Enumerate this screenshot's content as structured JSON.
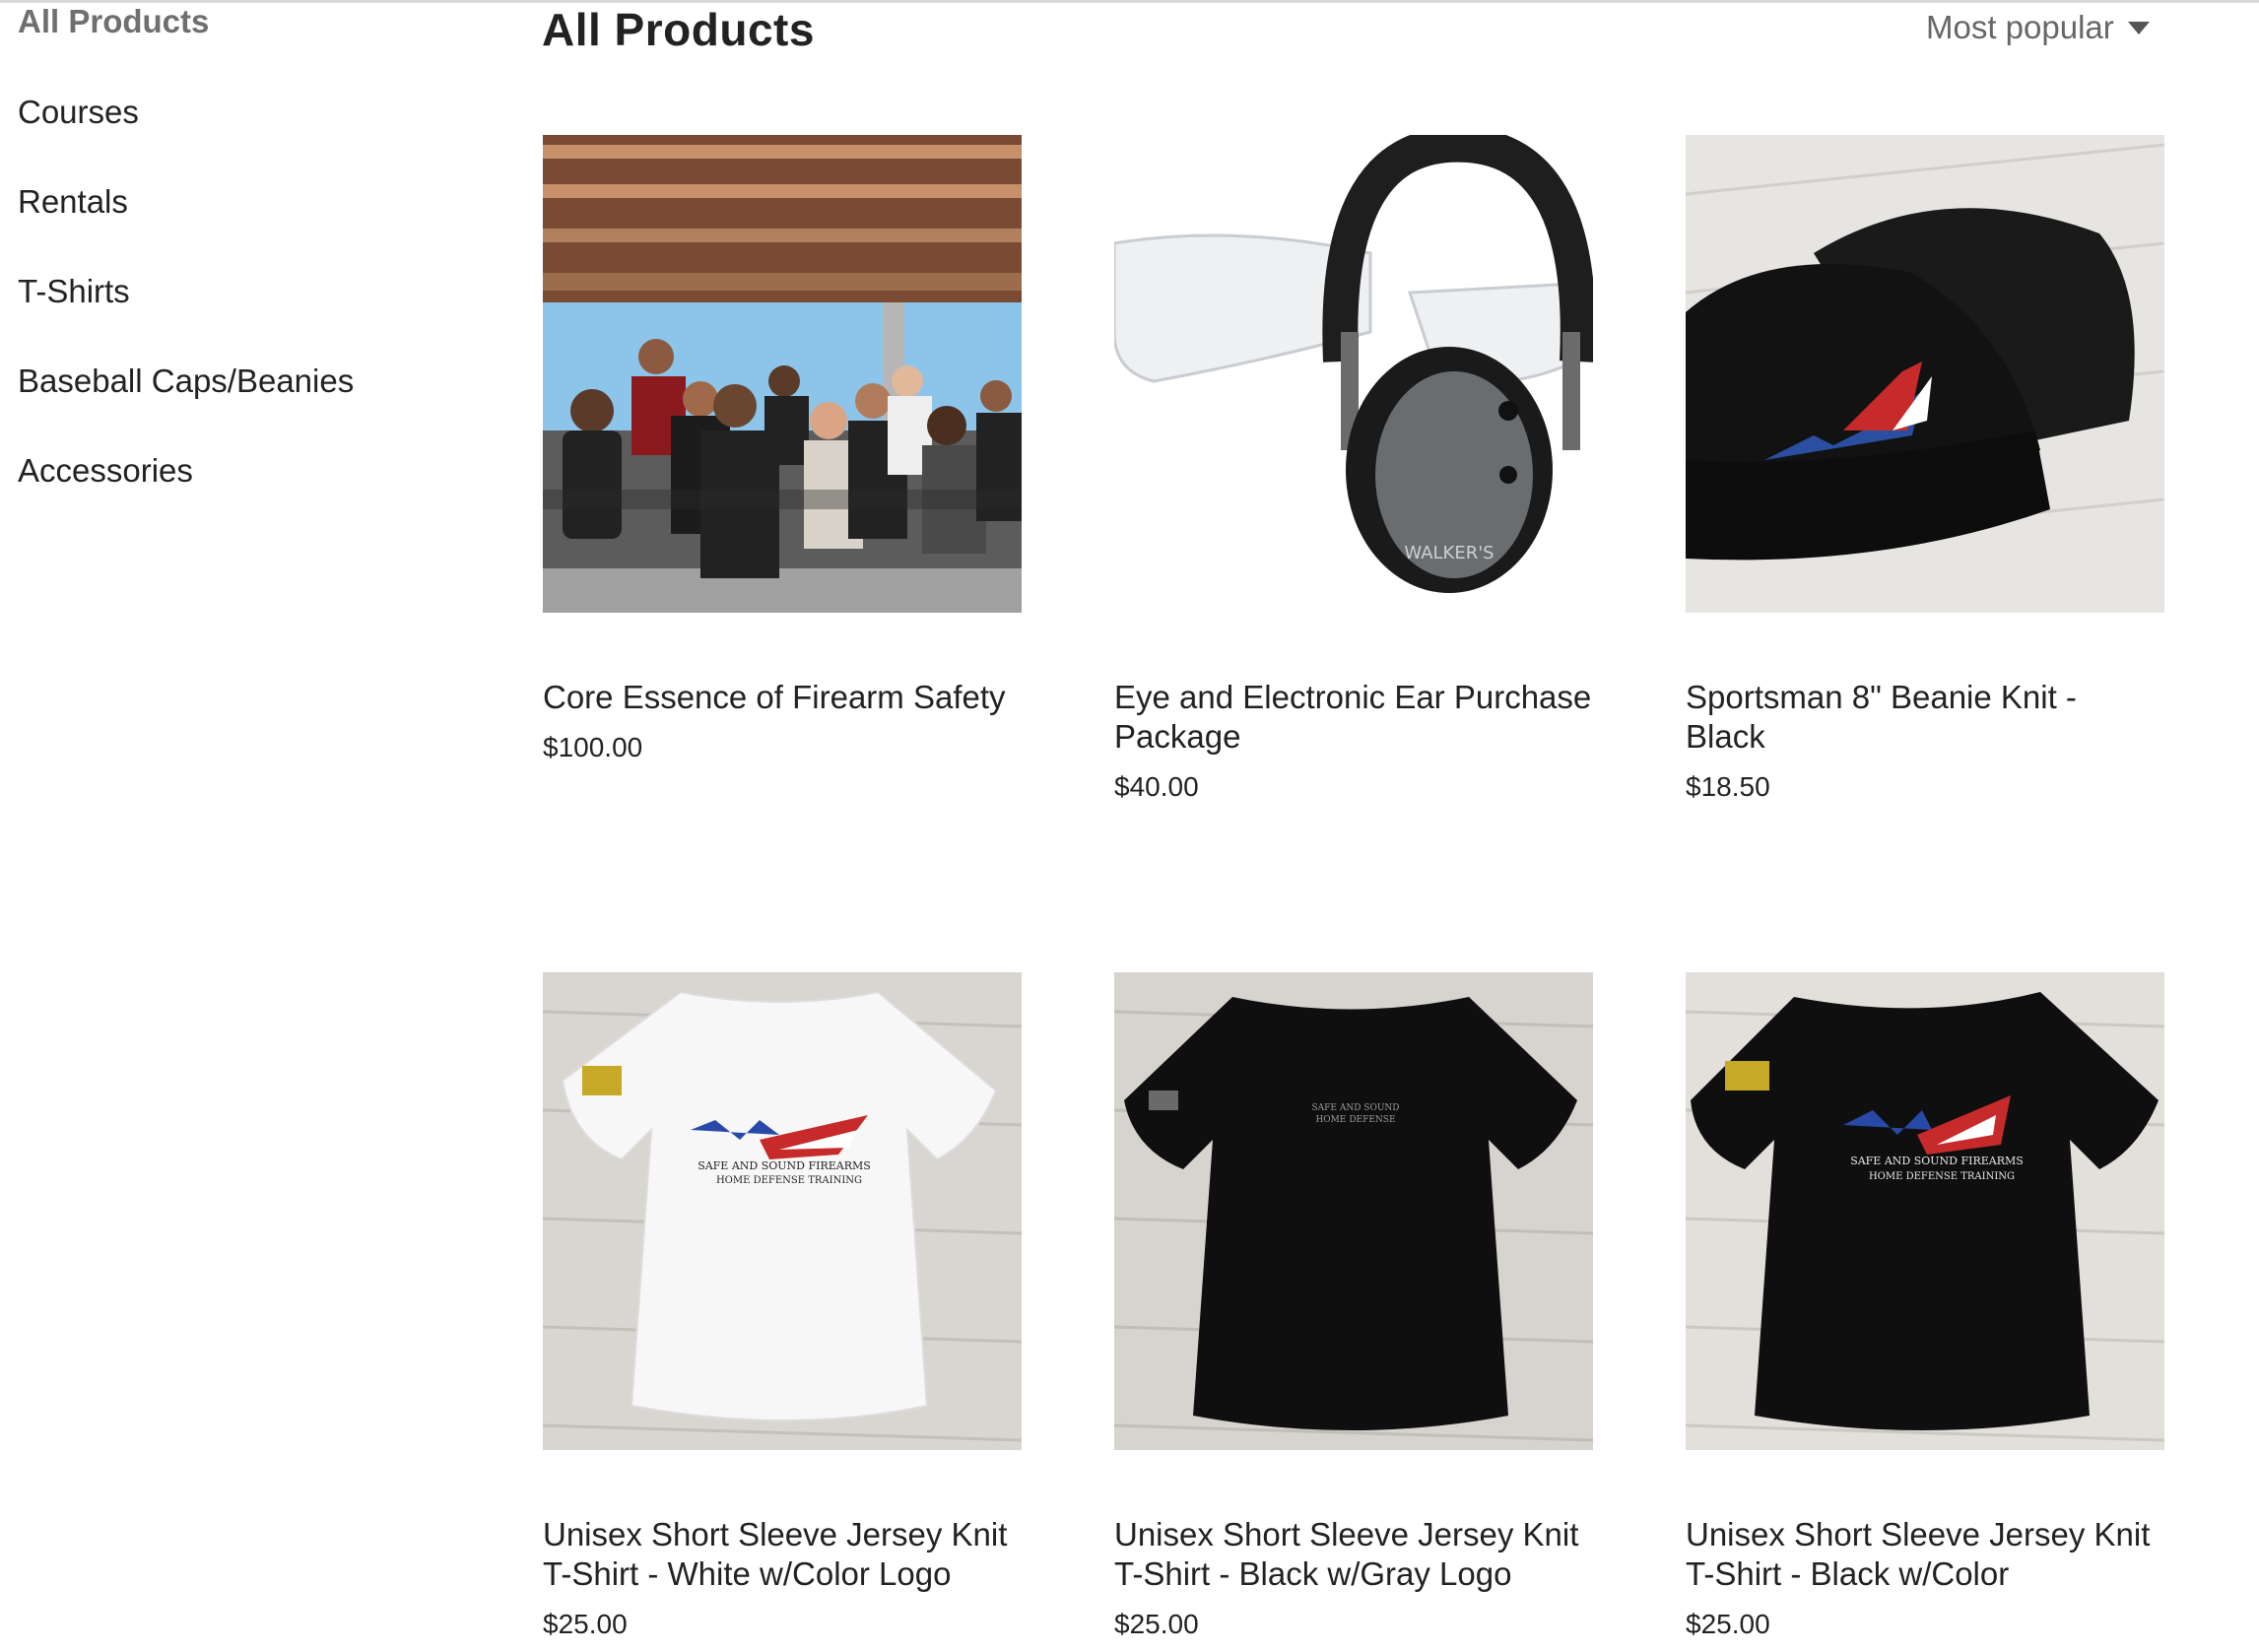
{
  "sidebar": {
    "items": [
      {
        "label": "All Products",
        "active": true
      },
      {
        "label": "Courses"
      },
      {
        "label": "Rentals"
      },
      {
        "label": "T-Shirts"
      },
      {
        "label": "Baseball Caps/Beanies"
      },
      {
        "label": "Accessories"
      }
    ]
  },
  "header": {
    "title": "All Products",
    "sort_label": "Most popular"
  },
  "products": [
    {
      "name": "Core Essence of Firearm Safety",
      "price": "$100.00",
      "image": "group-photo"
    },
    {
      "name": "Eye and Electronic Ear Purchase Package",
      "price": "$40.00",
      "image": "earmuffs-glasses"
    },
    {
      "name": "Sportsman 8\" Beanie Knit - Black",
      "price": "$18.50",
      "image": "black-beanie"
    },
    {
      "name": "Unisex Short Sleeve Jersey Knit T-Shirt - White w/Color Logo",
      "price": "$25.00",
      "image": "white-tshirt"
    },
    {
      "name": "Unisex Short Sleeve Jersey Knit T-Shirt - Black w/Gray Logo",
      "price": "$25.00",
      "image": "black-tshirt-gray-logo"
    },
    {
      "name": "Unisex Short Sleeve Jersey Knit T-Shirt - Black w/Color",
      "price": "$25.00",
      "image": "black-tshirt-color-logo"
    }
  ],
  "colors": {
    "active_category": "#6f6f6f",
    "text": "#222222",
    "sort_text": "#666666"
  }
}
